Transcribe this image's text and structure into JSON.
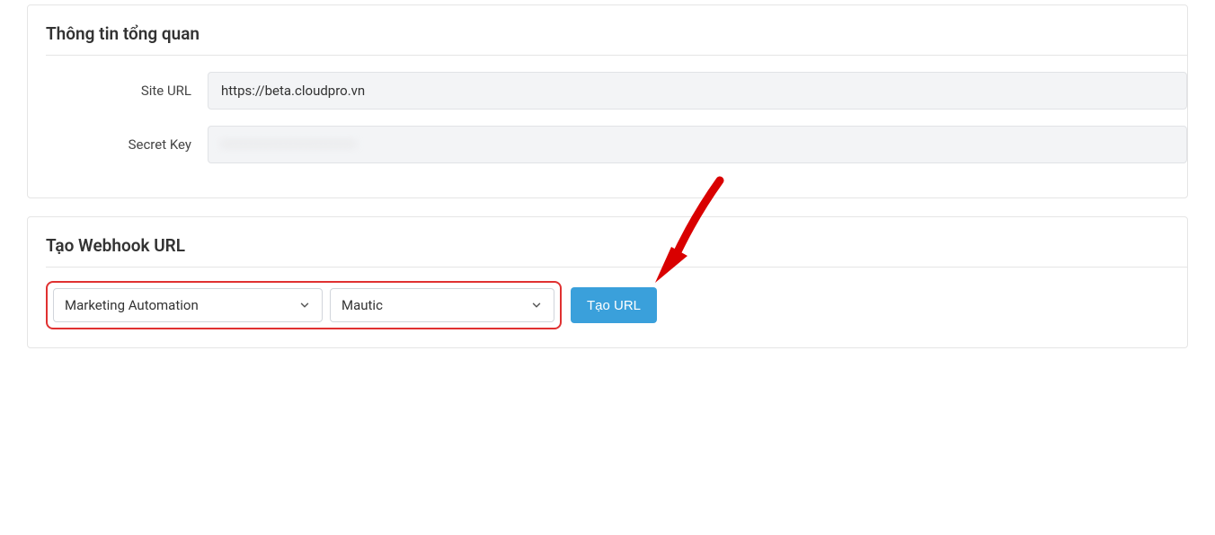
{
  "overview": {
    "title": "Thông tin tổng quan",
    "site_url_label": "Site URL",
    "site_url_value": "https://beta.cloudpro.vn",
    "secret_key_label": "Secret Key",
    "secret_key_placeholder": "•••••••••••••••••••••••••••"
  },
  "webhook": {
    "title": "Tạo Webhook URL",
    "select_category_value": "Marketing Automation",
    "select_provider_value": "Mautic",
    "create_button_label": "Tạo URL"
  },
  "colors": {
    "highlight_border": "#e03131",
    "button_bg": "#3aa0db",
    "arrow_fill": "#d90000"
  }
}
